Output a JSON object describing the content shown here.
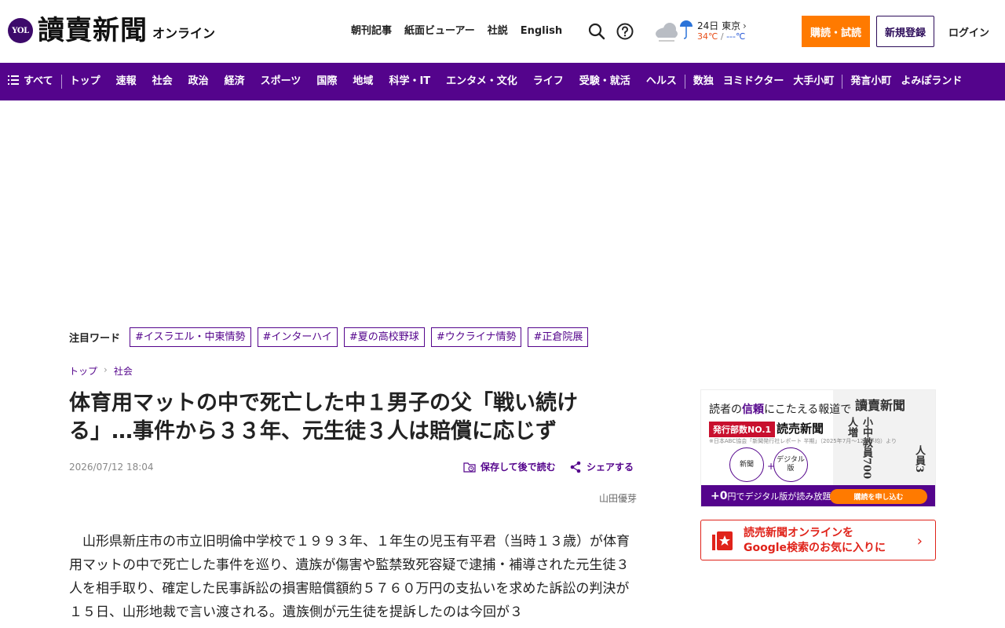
{
  "header": {
    "logo_badge": "YOL",
    "logo_name": "讀賣新聞",
    "logo_sub": "オンライン",
    "nav": [
      "朝刊記事",
      "紙面ビューアー",
      "社説",
      "English"
    ],
    "weather": {
      "date_city": "24日 東京",
      "temp_high": "34℃",
      "temp_sep": " / ",
      "temp_low": "---℃"
    },
    "subscribe_label": "購読・試読",
    "register_label": "新規登録",
    "login_label": "ログイン"
  },
  "categories": {
    "all_label": "すべて",
    "group1": [
      "トップ",
      "速報",
      "社会",
      "政治",
      "経済",
      "スポーツ",
      "国際",
      "地域",
      "科学・IT",
      "エンタメ・文化",
      "ライフ",
      "受験・就活",
      "ヘルス"
    ],
    "group2": [
      "数独",
      "ヨミドクター",
      "大手小町"
    ],
    "group3": [
      "発言小町",
      "よみぽランド"
    ]
  },
  "featured": {
    "label": "注目ワード",
    "tags": [
      "#イスラエル・中東情勢",
      "#インターハイ",
      "#夏の高校野球",
      "#ウクライナ情勢",
      "#正倉院展"
    ]
  },
  "breadcrumb": [
    "トップ",
    "社会"
  ],
  "article": {
    "title": "体育用マットの中で死亡した中１男子の父「戦い続ける」…事件から３３年、元生徒３人は賠償に応じず",
    "date": "2026/07/12 18:04",
    "save_label": "保存して後で読む",
    "share_label": "シェアする",
    "author": "山田優芽",
    "body": "山形県新庄市の市立旧明倫中学校で１９９３年、１年生の児玉有平君（当時１３歳）が体育用マットの中で死亡した事件を巡り、遺族が傷害や監禁致死容疑で逮捕・補導された元生徒３人を相手取り、確定した民事訴訟の損害賠償額約５７６０万円の支払いを求めた訴訟の判決が１５日、山形地裁で言い渡される。遺族側が元生徒を提訴したのは今回が３"
  },
  "promo": {
    "headline_pre": "読者の",
    "headline_em": "信頼",
    "headline_post": "にこたえる報道で",
    "badge": "発行部数NO.1",
    "paper_name": "読売新聞",
    "footnote": "※日本ABC協会「新聞発行社レポート 半期」（2025年7月〜12月平均）より",
    "circle1": "新聞",
    "circle2": "デジタル版",
    "plus": "+",
    "bar_text_pre": "+0",
    "bar_text_post": "円でデジタル版が読み放題！",
    "cta": "購読を申し込む",
    "paper_title": "讀賣新聞",
    "paper_headline1": "小中教員700人増",
    "paper_headline2": "人員3"
  },
  "google_fav": {
    "line1": "読売新聞オンラインを",
    "line2": "Google検索のお気に入りに"
  },
  "colors": {
    "brand_purple": "#54048c",
    "accent_orange": "#ff7a00",
    "google_red": "#e0231a"
  }
}
